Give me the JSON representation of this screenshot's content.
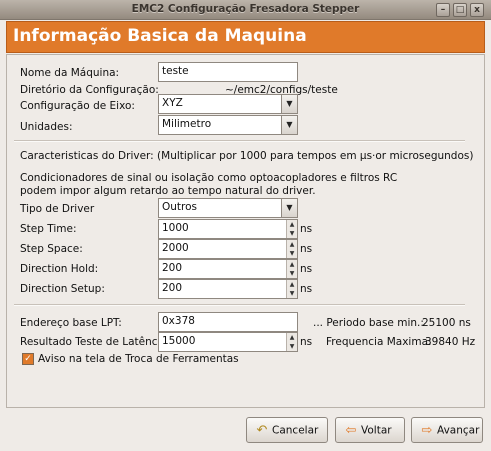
{
  "window": {
    "title": "EMC2 Configuração Fresadora Stepper",
    "controls": {
      "minimize": "–",
      "maximize": "□",
      "close": "x"
    }
  },
  "header": {
    "title": "Informação Basica da Maquina"
  },
  "machine": {
    "name_label": "Nome da Máquina:",
    "name_value": "teste",
    "config_dir_label": "Diretório da Configuração:",
    "config_dir_value": "~/emc2/configs/teste",
    "axis_config_label": "Configuração de Eixo:",
    "axis_config_value": "XYZ",
    "units_label": "Unidades:",
    "units_value": "Milimetro"
  },
  "driver": {
    "characteristics_text": "Caracteristicas do Driver: (Multiplicar por 1000 para tempos  em µs·or microsegundos)",
    "conditioners_line1": "Condicionadores de sinal ou isolação como optoacopladores e filtros RC",
    "conditioners_line2": "podem impor algum retardo ao tempo natural do driver.",
    "type_label": "Tipo de Driver",
    "type_value": "Outros",
    "step_time_label": "Step Time:",
    "step_time_value": "1000",
    "step_space_label": "Step Space:",
    "step_space_value": "2000",
    "direction_hold_label": "Direction Hold:",
    "direction_hold_value": "200",
    "direction_setup_label": "Direction Setup:",
    "direction_setup_value": "200",
    "unit_ns": "ns"
  },
  "lpt": {
    "base_label": "Endereço base LPT:",
    "base_value": "0x378",
    "period_label": "... Periodo base min.:",
    "period_value": "25100 ns",
    "latency_label": "Resultado Teste de Latência:",
    "latency_value": "15000",
    "latency_unit": "ns",
    "freq_label": "Frequencia Maxima:",
    "freq_value": "39840 Hz",
    "toolchange_label": "Aviso na tela de Troca de Ferramentas",
    "toolchange_checked": true
  },
  "footer": {
    "cancel_label": "Cancelar",
    "back_label": "Voltar",
    "forward_label": "Avançar"
  }
}
